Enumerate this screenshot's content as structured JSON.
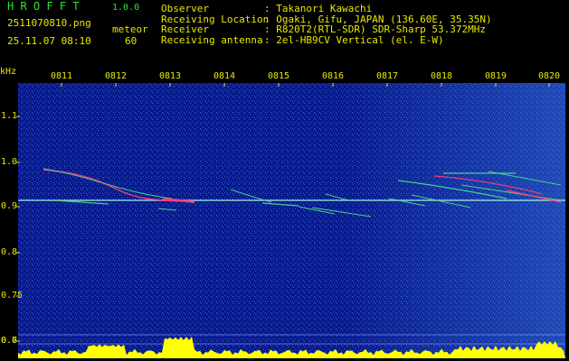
{
  "header": {
    "app_title": "H R O F F T",
    "app_version": "1.0.0",
    "filename": "2511070810.png",
    "meteor_label": "meteor",
    "datetime": "25.11.07 08:10",
    "meteor_count": "60"
  },
  "info": {
    "observer_label": "Observer",
    "observer_value": ": Takanori Kawachi",
    "location_label": "Receiving Location",
    "location_value": ": Ogaki, Gifu, JAPAN (136.60E, 35.35N)",
    "receiver_label": "Receiver",
    "receiver_value": ": R820T2(RTL-SDR) SDR-Sharp 53.372MHz",
    "antenna_label": "Receiving antenna",
    "antenna_value": ": 2el-HB9CV Vertical (el. E-W)"
  },
  "axes": {
    "y_unit": "kHz",
    "x_ticks": [
      "0811",
      "0812",
      "0813",
      "0814",
      "0815",
      "0816",
      "0817",
      "0818",
      "0819",
      "0820"
    ],
    "y_ticks": [
      "1.1",
      "1.0",
      "0.9",
      "0.8",
      "0.75",
      "0.7",
      "0.6"
    ]
  },
  "colors": {
    "background": "#000000",
    "text_yellow": "#e8e800",
    "title_green": "#2fe52f",
    "spectrogram_low": "#0a1f8a",
    "carrier": "#a0f0e0",
    "echo": "#4ee08a",
    "echo_hot": "#ff4070",
    "power_fill": "#ffff00"
  }
}
